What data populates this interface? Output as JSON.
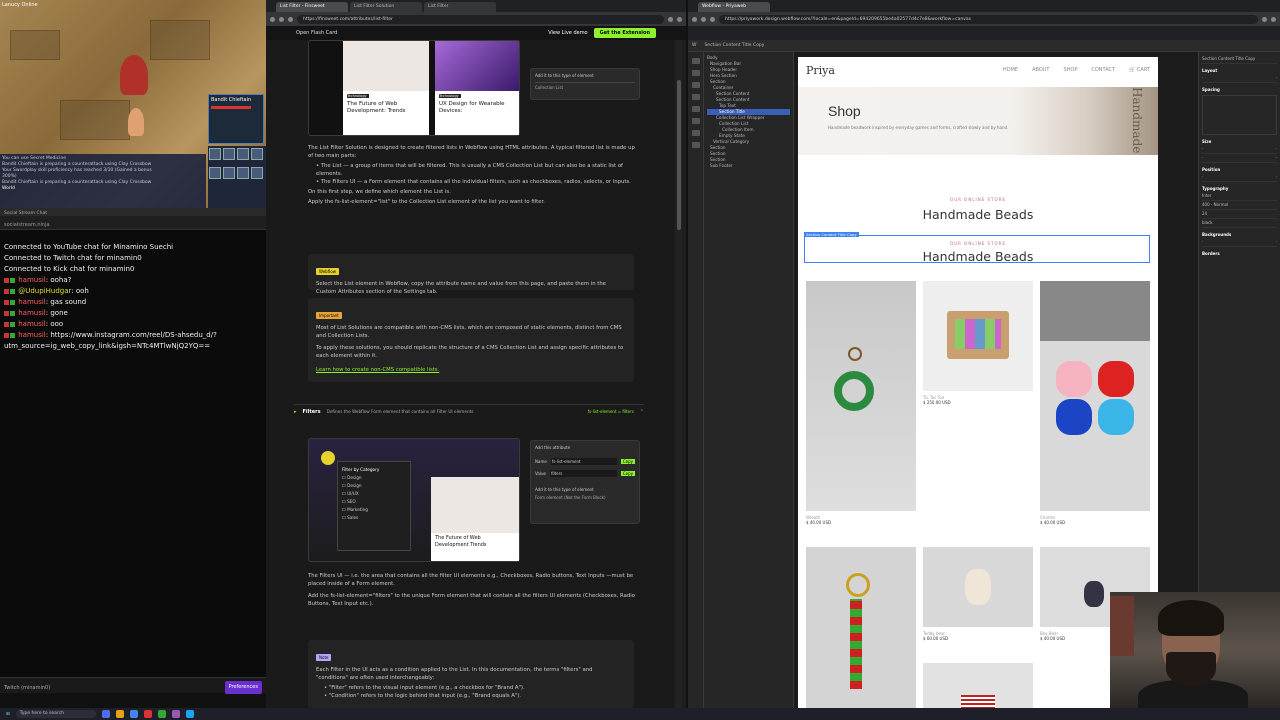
{
  "game": {
    "hud_title": "Lanucy Online",
    "hud_lines": [
      "Bandit Chieftain"
    ],
    "chat_lines": [
      "You can use Secret Medicine",
      "Bandit Chieftain is preparing a counterattack using Clay Crossbow",
      "Your Swordplay skill proficiency has reached 3/10 (Gained a bonus",
      "300%)",
      "Bandit Chieftain is preparing a counterattack using Clay Crossbow"
    ],
    "minimap_label": "Bandit Chieftain",
    "world_label": "World"
  },
  "chat": {
    "tabs_text": "Social Stream Chat",
    "toolbar_text": "socialstream.ninja",
    "connected": [
      "Connected to YouTube chat for Minamino Suechi",
      "Connected to Twitch chat for minamin0",
      "Connected to Kick chat for minamin0"
    ],
    "messages": [
      {
        "user": "hamusil",
        "text": "ooha?"
      },
      {
        "user": "@UdupiHudgar",
        "text": "ooh"
      },
      {
        "user": "hamusil",
        "text": "gas sound"
      },
      {
        "user": "hamusil",
        "text": "gone"
      },
      {
        "user": "hamusil",
        "text": "ooo"
      },
      {
        "user": "hamusil",
        "text": "https://www.instagram.com/reel/DS-ahsedu_d/?"
      },
      {
        "user": "",
        "text": "utm_source=ig_web_copy_link&igsh=NTc4MTlwNjQ2YQ=="
      }
    ],
    "footer_text": "Twitch (minamin0)",
    "preferences_label": "Preferences"
  },
  "browser1": {
    "tabs": [
      "List Filter - Finsweet",
      "List Filter Solution",
      "List Filter"
    ],
    "url": "https://finsweet.com/attributes/list-filter",
    "open_flash_card": "Open Flash Card",
    "view_live_demo": "View Live demo",
    "cta": "Get the Extension",
    "card1_title": "The Future of Web Development: Trends",
    "card2_title": "UX Design for Wearable Devices:",
    "card_tag": "Technology",
    "attr_panel_hint": "Add it to this type of element",
    "attr_panel_item": "Collection List",
    "intro": "The List Filter Solution is designed to create filtered lists in Webflow using HTML attributes. A typical filtered list is made up of two main parts:",
    "bullet1": "The List — a group of items that will be filtered. This is usually a CMS Collection List but can also be a static list of elements.",
    "bullet2": "The Filters UI — a Form element that contains all the individual filters, such as checkboxes, radios, selects, or inputs.",
    "step_text": "On this first step, we define which element the List is.",
    "apply_text": "Apply the fs-list-element=\"list\" to the Collection List element of the list you want to filter.",
    "badge1": "Webflow",
    "note1": "Select the List element in Webflow, copy the attribute name and value from this page, and paste them in the Custom Attributes section of the Settings tab.",
    "badge2": "Important",
    "note2a": "Most of List Solutions are compatible with non-CMS lists, which are composed of static elements, distinct from CMS and Collection Lists.",
    "note2b": "To apply these solutions, you should replicate the structure of a CMS Collection List and assign specific attributes to each element within it.",
    "note2_link": "Learn how to create non-CMS compatible lists.",
    "filters_label": "Filters",
    "filters_desc": "Defines the Webflow Form element that contains all Filter UI elements",
    "filters_attr": "fs-list-element = filters",
    "demo_heading": "Filter by Category",
    "demo_items": [
      "Design",
      "Design",
      "UI/UX",
      "SEO",
      "Marketing",
      "Sales"
    ],
    "demo_card_title": "The Future of Web Development Trends",
    "attr2_hint": "Add this attribute",
    "attr2_name_label": "Name",
    "attr2_name_value": "fs-list-element",
    "attr2_value_label": "Value",
    "attr2_value_value": "filters",
    "attr2_copy": "Copy",
    "attr2_element_hint": "Add it to this type of element",
    "attr2_element": "Form element (Not the Form Block)",
    "filters_text": "The Filters UI — i.e. the area that contains all the filter UI elements e.g., Checkboxes, Radio buttons, Text Inputs —must be placed inside of a Form element.",
    "filters_text2": "Add the fs-list-element=\"filters\" to the unique Form element that will contain all the filters UI elements (Checkboxes, Radio Buttons, Text Input etc.).",
    "badge3": "Note",
    "note3": "Each Filter in the UI acts as a condition applied to the List. In this documentation, the terms \"filters\" and \"conditions\" are often used interchangeably:",
    "note3_b1": "\"Filter\" refers to the visual input element (e.g., a checkbox for \"Brand A\").",
    "note3_b2": "\"Condition\" refers to the logic behind that input (e.g., \"Brand equals A\")."
  },
  "browser2": {
    "tab": "Webflow - Priyaweb",
    "url": "https://priyawork.design.webflow.com/?locale=en&pageId=694209655be4a02577d4c7e8&workflow=canvas",
    "nav_items": [
      "Body",
      "Navigation Bar",
      "Shop Header",
      "Hero Section",
      "Section",
      "Container",
      "Section Content",
      "Section Content",
      "Top Text",
      "Section Title",
      "Collection List Wrapper",
      "Collection List",
      "Collection Item",
      "Empty State",
      "Vertical Category",
      "Section",
      "Section",
      "Section",
      "Sub Footer"
    ],
    "nav_selected_index": 9,
    "right_panel": {
      "selector_label": "Section Content Title Copy",
      "headers": [
        "Layout",
        "Spacing",
        "Size",
        "Position",
        "Typography",
        "Backgrounds",
        "Borders"
      ],
      "font": "Inter",
      "weight": "400 - Normal",
      "size": "24",
      "color": "black"
    },
    "site": {
      "logo": "Priya",
      "nav_links": [
        "HOME",
        "ABOUT",
        "SHOP",
        "CONTACT",
        "CART"
      ],
      "hero_title": "Shop",
      "hero_sub": "Handmade beadwork inspired by everyday games and forms, crafted slowly and by hand.",
      "hero_side": "Handmade",
      "eyebrow": "OUR ONLINE STORE",
      "section_title": "Handmade Beads",
      "eyebrow2": "OUR ONLINE STORE",
      "section_title2": "Handmade Beads",
      "selected_label": "Section Content Title Copy",
      "products": [
        {
          "name": "Wreath",
          "price": "$ 40.00 USD"
        },
        {
          "name": "Tic Tac Toe",
          "price": "$ 250.00 USD"
        },
        {
          "name": "Charms",
          "price": "$ 40.00 USD"
        },
        {
          "name": "",
          "price": ""
        },
        {
          "name": "Teddy bear",
          "price": "$ 60.00 USD"
        },
        {
          "name": "Boy Bear",
          "price": "$ 40.00 USD"
        },
        {
          "name": "",
          "price": ""
        }
      ]
    }
  },
  "taskbar": {
    "search_placeholder": "Type here to search",
    "time": ""
  },
  "colors": {
    "accent_green": "#8ef12e",
    "webflow_blue": "#3b82f6",
    "chat_user": "#ff5d5d"
  }
}
